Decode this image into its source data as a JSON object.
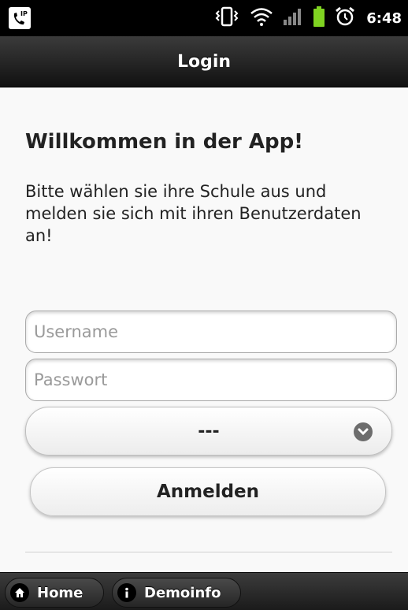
{
  "status_bar": {
    "time": "6:48",
    "icons": [
      "vpn-ip-icon",
      "vibrate-icon",
      "wifi-icon",
      "signal-icon",
      "battery-icon",
      "alarm-icon"
    ]
  },
  "header": {
    "title": "Login"
  },
  "main": {
    "welcome": "Willkommen in der App!",
    "intro": "Bitte wählen sie ihre Schule aus und melden sie sich mit ihren Benutzerdaten an!",
    "username": {
      "placeholder": "Username",
      "value": ""
    },
    "password": {
      "placeholder": "Passwort",
      "value": ""
    },
    "school_select": {
      "selected": "---"
    },
    "login_button": "Anmelden"
  },
  "footer": {
    "tabs": [
      {
        "label": "Home",
        "icon": "home-icon"
      },
      {
        "label": "Demoinfo",
        "icon": "info-icon"
      }
    ]
  },
  "colors": {
    "battery": "#7fd321",
    "header_bg": "#1a1a1a",
    "footer_bg": "#2a2a2a"
  }
}
